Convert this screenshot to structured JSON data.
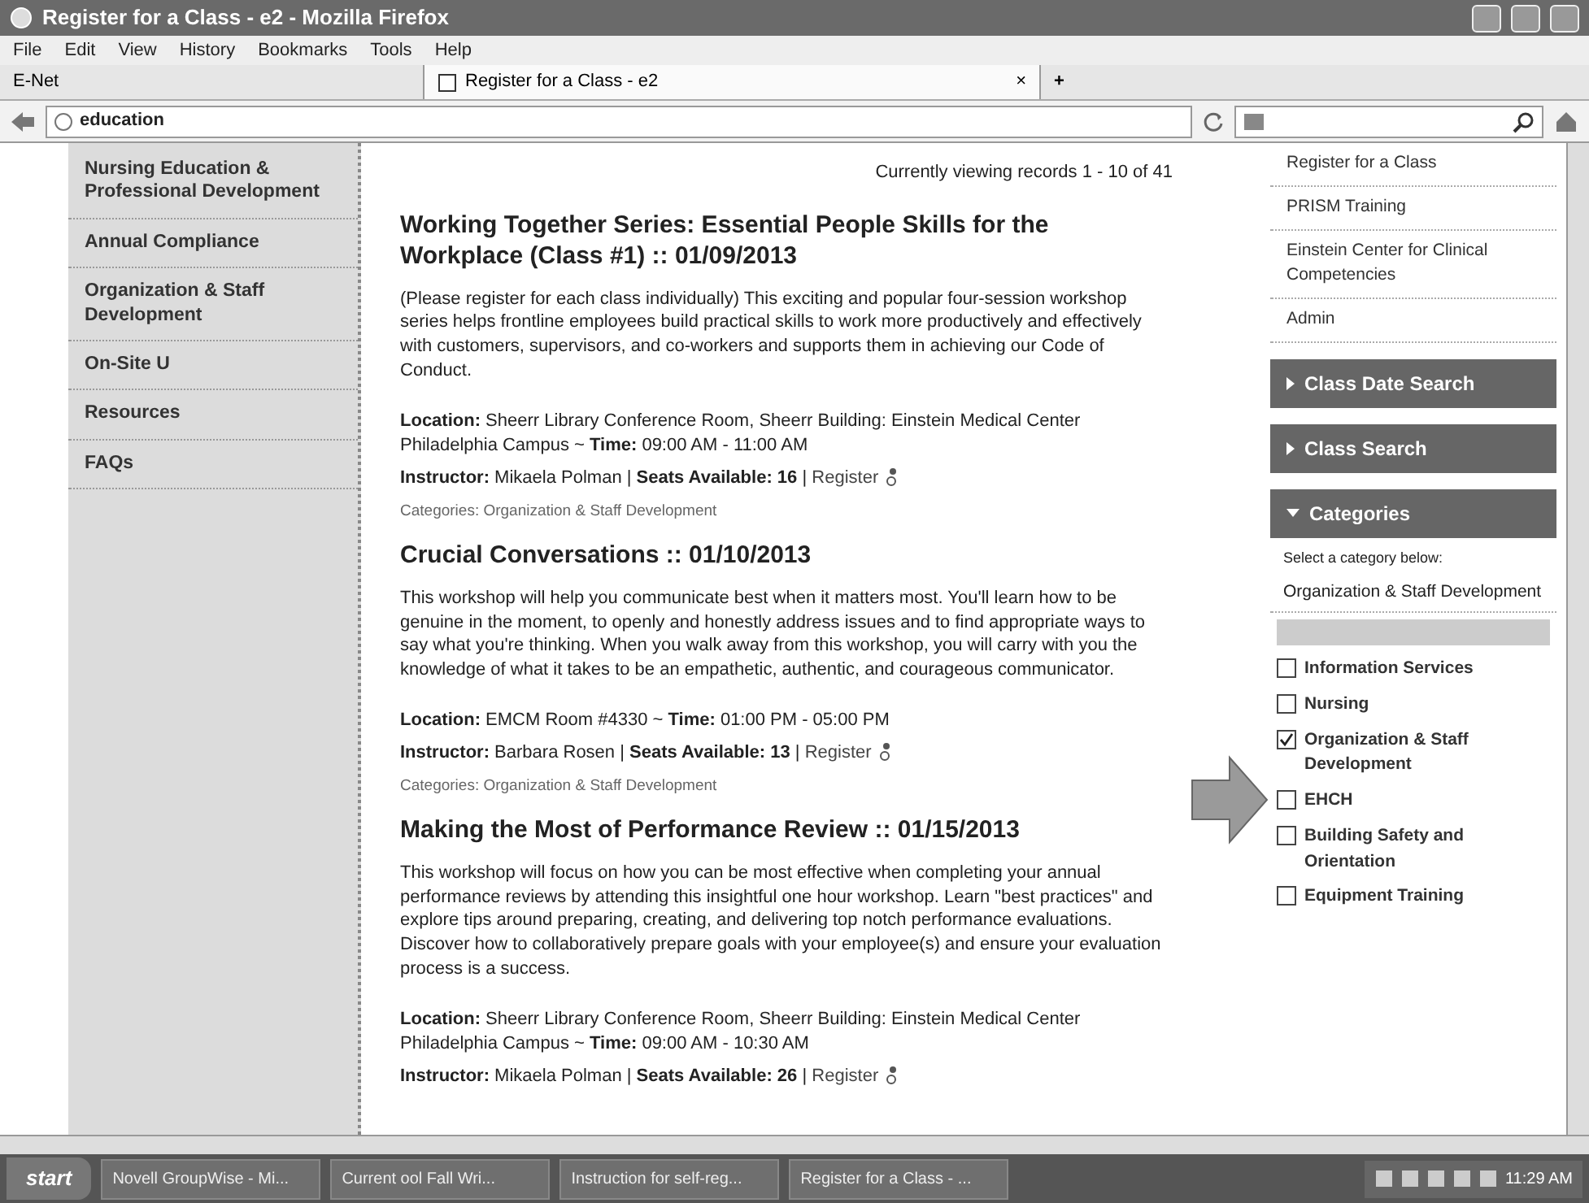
{
  "window": {
    "title": "Register for a Class - e2 - Mozilla Firefox"
  },
  "menu": [
    "File",
    "Edit",
    "View",
    "History",
    "Bookmarks",
    "Tools",
    "Help"
  ],
  "tabs": [
    {
      "label": "E-Net",
      "selected": false
    },
    {
      "label": "Register for a Class - e2",
      "selected": true
    }
  ],
  "tab_close": "×",
  "new_tab": "+",
  "address": {
    "value": "education"
  },
  "left_nav": [
    {
      "label": "Nursing Education & Professional Development"
    },
    {
      "label": "Annual Compliance"
    },
    {
      "label": "Organization & Staff Development"
    },
    {
      "label": "On-Site U"
    },
    {
      "label": "Resources"
    },
    {
      "label": "FAQs"
    }
  ],
  "records": "Currently viewing records 1 - 10 of 41",
  "classes": [
    {
      "title": "Working Together Series: Essential People Skills for the Workplace (Class #1) :: 01/09/2013",
      "description": "(Please register for each class individually) This exciting and popular four-session workshop series helps frontline employees build practical skills to work more productively and effectively with customers, supervisors, and co-workers and supports them in achieving our Code of Conduct.",
      "details": "**Location:** Sheerr Library Conference Room, Sheerr Building: Einstein Medical Center Philadelphia Campus ~ **Time:** 09:00 AM - 11:00 AM",
      "instructor": "**Instructor:** Mikaela Polman | **Seats Available: 16** |",
      "register": "Register",
      "categories": "Categories: Organization & Staff Development"
    },
    {
      "title": "Crucial Conversations :: 01/10/2013",
      "description": "This workshop will help you communicate best when it matters most. You'll learn how to be genuine in the moment, to openly and honestly address issues and to find appropriate ways to say what you're thinking. When you walk away from this workshop, you will carry with you the knowledge of what it takes to be an empathetic, authentic, and courageous communicator.",
      "details": "**Location:** EMCM Room #4330 ~ **Time:** 01:00 PM - 05:00 PM",
      "instructor": "**Instructor:** Barbara Rosen | **Seats Available: 13** |",
      "register": "Register",
      "categories": "Categories: Organization & Staff Development"
    },
    {
      "title": "Making the Most of Performance Review :: 01/15/2013",
      "description": "This workshop will focus on how you can be most effective when completing your annual performance reviews by attending this insightful one hour workshop. Learn \"best practices\" and explore tips around preparing, creating, and delivering top notch performance evaluations. Discover how to collaboratively prepare goals with your employee(s) and ensure your evaluation process is a success.",
      "details": "**Location:** Sheerr Library Conference Room, Sheerr Building: Einstein Medical Center Philadelphia Campus ~ **Time:** 09:00 AM - 10:30 AM",
      "instructor": "**Instructor:** Mikaela Polman | **Seats Available: 26** |",
      "register": "Register"
    }
  ],
  "right_nav": [
    "Register for a Class",
    "PRISM Training",
    "Einstein Center for Clinical Competencies",
    "Admin"
  ],
  "panels": [
    {
      "title": "Class Date Search",
      "expanded": false
    },
    {
      "title": "Class Search",
      "expanded": false
    },
    {
      "title": "Categories",
      "expanded": true
    }
  ],
  "categories": {
    "prompt": "Select a category below:",
    "select_value": "Organization & Staff Development",
    "options": [
      {
        "label": "Information Services",
        "checked": false
      },
      {
        "label": "Nursing",
        "checked": false
      },
      {
        "label": "Organization & Staff Development",
        "checked": true
      },
      {
        "label": "EHCH",
        "checked": false
      },
      {
        "label": "Building Safety and Orientation",
        "checked": false
      },
      {
        "label": "Equipment Training",
        "checked": false
      }
    ]
  },
  "taskbar": {
    "start": "start",
    "tasks": [
      "Novell GroupWise - Mi...",
      "Current ool Fall Wri...",
      "Instruction for self-reg...",
      "Register for a Class - ..."
    ],
    "clock": "11:29 AM"
  }
}
